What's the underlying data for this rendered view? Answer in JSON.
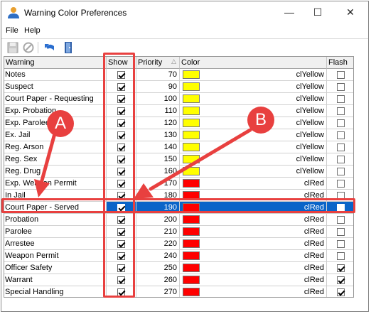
{
  "window": {
    "title": "Warning Color Preferences",
    "minimize_glyph": "—",
    "maximize_glyph": "☐",
    "close_glyph": "✕"
  },
  "menu": {
    "file": "File",
    "help": "Help"
  },
  "toolbar": {
    "icons": [
      "save-icon",
      "cancel-icon",
      "undo-icon",
      "exit-door-icon"
    ]
  },
  "grid": {
    "columns": {
      "warning": "Warning",
      "show": "Show",
      "priority": "Priority",
      "color": "Color",
      "flash": "Flash"
    },
    "sort_indicator": "△",
    "rows": [
      {
        "warning": "Notes",
        "show": true,
        "priority": "70",
        "color_name": "clYellow",
        "color_hex": "#ffff00",
        "flash": false,
        "selected": false
      },
      {
        "warning": "Suspect",
        "show": true,
        "priority": "90",
        "color_name": "clYellow",
        "color_hex": "#ffff00",
        "flash": false,
        "selected": false
      },
      {
        "warning": "Court Paper - Requesting",
        "show": true,
        "priority": "100",
        "color_name": "clYellow",
        "color_hex": "#ffff00",
        "flash": false,
        "selected": false
      },
      {
        "warning": "Exp. Probation",
        "show": true,
        "priority": "110",
        "color_name": "clYellow",
        "color_hex": "#ffff00",
        "flash": false,
        "selected": false
      },
      {
        "warning": "Exp. Parolee",
        "show": true,
        "priority": "120",
        "color_name": "clYellow",
        "color_hex": "#ffff00",
        "flash": false,
        "selected": false
      },
      {
        "warning": "Ex. Jail",
        "show": true,
        "priority": "130",
        "color_name": "clYellow",
        "color_hex": "#ffff00",
        "flash": false,
        "selected": false
      },
      {
        "warning": "Reg. Arson",
        "show": true,
        "priority": "140",
        "color_name": "clYellow",
        "color_hex": "#ffff00",
        "flash": false,
        "selected": false
      },
      {
        "warning": "Reg. Sex",
        "show": true,
        "priority": "150",
        "color_name": "clYellow",
        "color_hex": "#ffff00",
        "flash": false,
        "selected": false
      },
      {
        "warning": "Reg. Drug",
        "show": true,
        "priority": "160",
        "color_name": "clYellow",
        "color_hex": "#ffff00",
        "flash": false,
        "selected": false
      },
      {
        "warning": "Exp. Weapon Permit",
        "show": true,
        "priority": "170",
        "color_name": "clRed",
        "color_hex": "#ff0000",
        "flash": false,
        "selected": false
      },
      {
        "warning": "In Jail",
        "show": true,
        "priority": "180",
        "color_name": "clRed",
        "color_hex": "#ff0000",
        "flash": false,
        "selected": false
      },
      {
        "warning": "Court Paper - Served",
        "show": true,
        "priority": "190",
        "color_name": "clRed",
        "color_hex": "#ff0000",
        "flash": false,
        "selected": true
      },
      {
        "warning": "Probation",
        "show": true,
        "priority": "200",
        "color_name": "clRed",
        "color_hex": "#ff0000",
        "flash": false,
        "selected": false
      },
      {
        "warning": "Parolee",
        "show": true,
        "priority": "210",
        "color_name": "clRed",
        "color_hex": "#ff0000",
        "flash": false,
        "selected": false
      },
      {
        "warning": "Arrestee",
        "show": true,
        "priority": "220",
        "color_name": "clRed",
        "color_hex": "#ff0000",
        "flash": false,
        "selected": false
      },
      {
        "warning": "Weapon Permit",
        "show": true,
        "priority": "240",
        "color_name": "clRed",
        "color_hex": "#ff0000",
        "flash": false,
        "selected": false
      },
      {
        "warning": "Officer Safety",
        "show": true,
        "priority": "250",
        "color_name": "clRed",
        "color_hex": "#ff0000",
        "flash": true,
        "selected": false
      },
      {
        "warning": "Warrant",
        "show": true,
        "priority": "260",
        "color_name": "clRed",
        "color_hex": "#ff0000",
        "flash": true,
        "selected": false
      },
      {
        "warning": "Special Handling",
        "show": true,
        "priority": "270",
        "color_name": "clRed",
        "color_hex": "#ff0000",
        "flash": true,
        "selected": false
      }
    ]
  },
  "annotations": {
    "callout_a": "A",
    "callout_b": "B",
    "accent_color": "#e8403f"
  }
}
